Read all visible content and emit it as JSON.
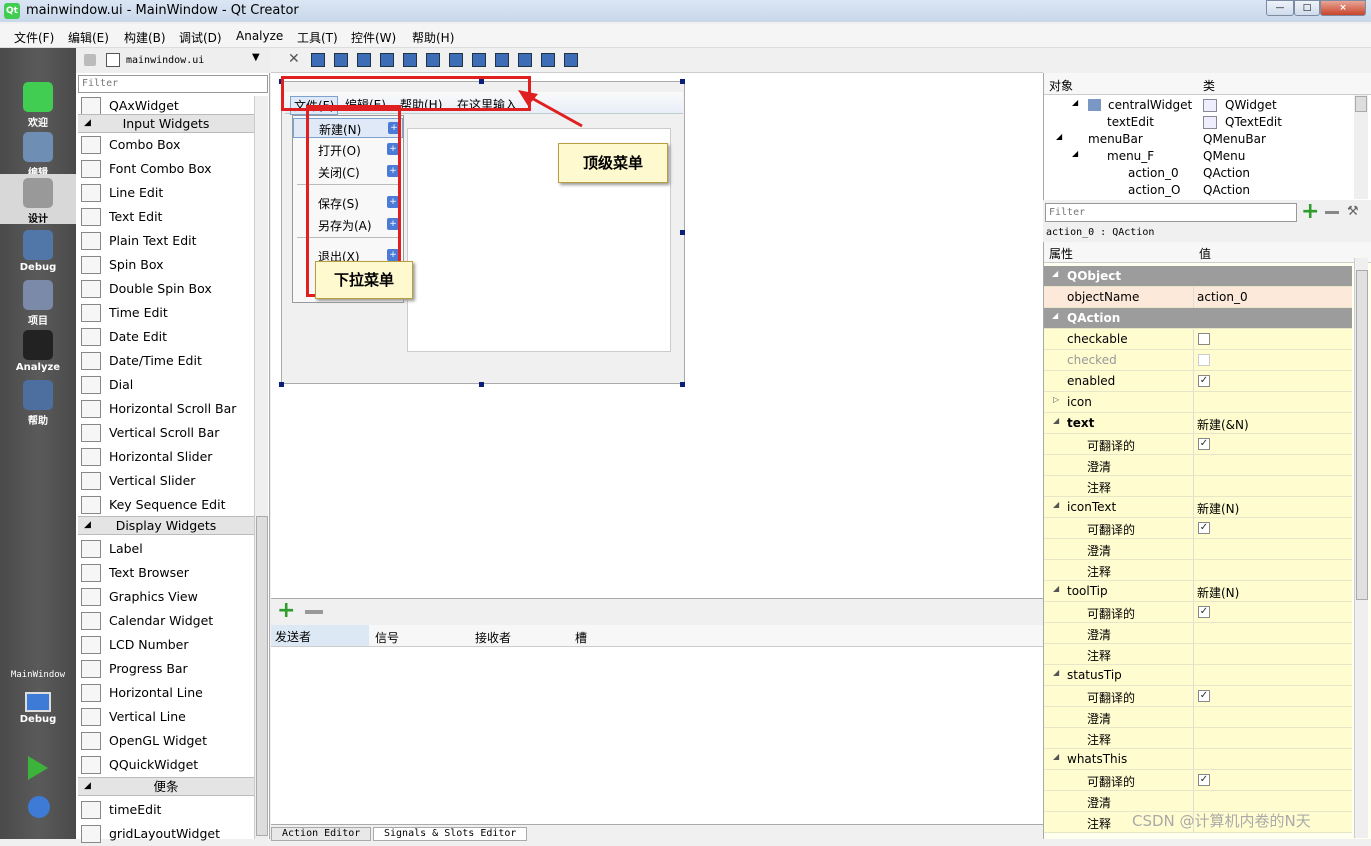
{
  "window": {
    "title": "mainwindow.ui - MainWindow - Qt Creator",
    "min": "—",
    "max": "□",
    "close": "×"
  },
  "menubar": [
    "文件(F)",
    "编辑(E)",
    "构建(B)",
    "调试(D)",
    "Analyze",
    "工具(T)",
    "控件(W)",
    "帮助(H)"
  ],
  "modes": [
    {
      "label": "欢迎",
      "icon": "qt-icon"
    },
    {
      "label": "编辑",
      "icon": "edit-icon"
    },
    {
      "label": "设计",
      "icon": "design-icon"
    },
    {
      "label": "Debug",
      "icon": "debug-icon"
    },
    {
      "label": "项目",
      "icon": "project-icon"
    },
    {
      "label": "Analyze",
      "icon": "analyze-icon"
    },
    {
      "label": "帮助",
      "icon": "help-icon"
    }
  ],
  "target": {
    "label": "MainWindow",
    "mode": "Debug"
  },
  "widgetbox": {
    "filter_placeholder": "Filter",
    "open_file": "mainwindow.ui"
  },
  "widgets": {
    "top": "QAxWidget",
    "input_cat": "Input Widgets",
    "input": [
      "Combo Box",
      "Font Combo Box",
      "Line Edit",
      "Text Edit",
      "Plain Text Edit",
      "Spin Box",
      "Double Spin Box",
      "Time Edit",
      "Date Edit",
      "Date/Time Edit",
      "Dial",
      "Horizontal Scroll Bar",
      "Vertical Scroll Bar",
      "Horizontal Slider",
      "Vertical Slider",
      "Key Sequence Edit"
    ],
    "display_cat": "Display Widgets",
    "display": [
      "Label",
      "Text Browser",
      "Graphics View",
      "Calendar Widget",
      "LCD Number",
      "Progress Bar",
      "Horizontal Line",
      "Vertical Line",
      "OpenGL Widget",
      "QQuickWidget"
    ],
    "misc_cat": "便条",
    "misc": [
      "timeEdit",
      "gridLayoutWidget"
    ]
  },
  "form": {
    "menus": [
      "文件(F)",
      "编辑(E)",
      "帮助(H)",
      "在这里输入"
    ],
    "dropdown": [
      "新建(N)",
      "打开(O)",
      "关闭(C)",
      "保存(S)",
      "另存为(A)",
      "退出(X)"
    ],
    "callout_top": "顶级菜单",
    "callout_drop": "下拉菜单"
  },
  "signals": {
    "headers": [
      "发送者",
      "信号",
      "接收者",
      "槽"
    ],
    "tabs": [
      "Action Editor",
      "Signals & Slots Editor"
    ]
  },
  "objects": {
    "headers": [
      "对象",
      "类"
    ],
    "rows": [
      [
        "centralWidget",
        "QWidget"
      ],
      [
        "textEdit",
        "QTextEdit"
      ],
      [
        "menuBar",
        "QMenuBar"
      ],
      [
        "menu_F",
        "QMenu"
      ],
      [
        "action_0",
        "QAction"
      ],
      [
        "action_O",
        "QAction"
      ]
    ]
  },
  "props": {
    "filter_placeholder": "Filter",
    "class_line": "action_0 : QAction",
    "headers": [
      "属性",
      "值"
    ],
    "rows": [
      {
        "n": "QObject",
        "g": true
      },
      {
        "n": "objectName",
        "v": "action_0",
        "sel": true
      },
      {
        "n": "QAction",
        "g": true
      },
      {
        "n": "checkable",
        "cb": ""
      },
      {
        "n": "checked",
        "cb": "",
        "dis": true
      },
      {
        "n": "enabled",
        "cb": "✓"
      },
      {
        "n": "icon",
        "t": "▷"
      },
      {
        "n": "text",
        "v": "新建(&N)",
        "t": "◢",
        "b": true
      },
      {
        "n": "可翻译的",
        "cb": "✓",
        "s": true
      },
      {
        "n": "澄清",
        "s": true
      },
      {
        "n": "注释",
        "s": true
      },
      {
        "n": "iconText",
        "v": "新建(N)",
        "t": "◢"
      },
      {
        "n": "可翻译的",
        "cb": "✓",
        "s": true
      },
      {
        "n": "澄清",
        "s": true
      },
      {
        "n": "注释",
        "s": true
      },
      {
        "n": "toolTip",
        "v": "新建(N)",
        "t": "◢"
      },
      {
        "n": "可翻译的",
        "cb": "✓",
        "s": true
      },
      {
        "n": "澄清",
        "s": true
      },
      {
        "n": "注释",
        "s": true
      },
      {
        "n": "statusTip",
        "t": "◢"
      },
      {
        "n": "可翻译的",
        "cb": "✓",
        "s": true
      },
      {
        "n": "澄清",
        "s": true
      },
      {
        "n": "注释",
        "s": true
      },
      {
        "n": "whatsThis",
        "t": "◢"
      },
      {
        "n": "可翻译的",
        "cb": "✓",
        "s": true
      },
      {
        "n": "澄清",
        "s": true
      },
      {
        "n": "注释",
        "s": true
      }
    ]
  },
  "watermark": "CSDN @计算机内卷的N天"
}
